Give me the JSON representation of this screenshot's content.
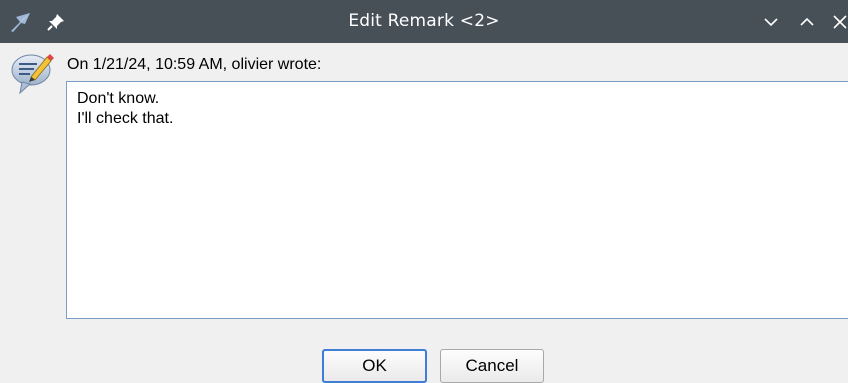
{
  "window": {
    "title": "Edit Remark <2>",
    "app_icon": "app-logo-icon",
    "pin_icon": "pin-icon",
    "controls": [
      "minimize-icon",
      "maximize-icon",
      "close-icon"
    ]
  },
  "remark": {
    "icon": "remark-note-icon",
    "header": "On 1/21/24, 10:59 AM, olivier wrote:",
    "text": "Don't know.\nI'll check that."
  },
  "buttons": {
    "ok_label": "OK",
    "cancel_label": "Cancel"
  },
  "colors": {
    "titlebar_bg": "#475057",
    "dialog_bg": "#f0f0f0",
    "focus_accent": "#3f7dd6"
  }
}
